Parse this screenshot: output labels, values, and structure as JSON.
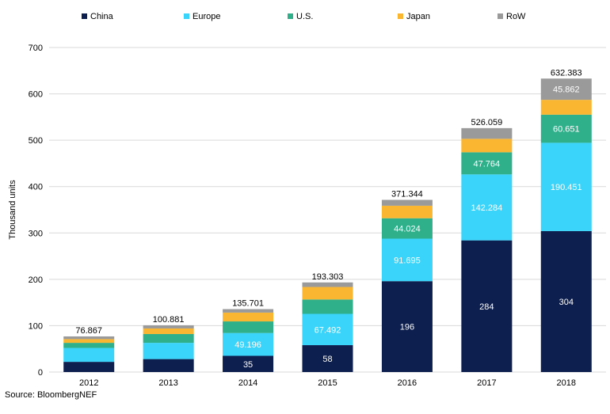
{
  "chart_data": {
    "type": "bar",
    "stacked": true,
    "categories": [
      "2012",
      "2013",
      "2014",
      "2015",
      "2016",
      "2017",
      "2018"
    ],
    "series": [
      {
        "name": "China",
        "color": "#0d1f4f",
        "values": [
          22,
          28,
          35,
          58,
          196,
          284,
          304
        ]
      },
      {
        "name": "Europe",
        "color": "#3ad4fa",
        "values": [
          30,
          35,
          49.196,
          67.492,
          91.695,
          142.284,
          190.451
        ]
      },
      {
        "name": "U.S.",
        "color": "#2fb08b",
        "values": [
          11,
          19,
          25,
          31,
          44.024,
          47.764,
          60.651
        ]
      },
      {
        "name": "Japan",
        "color": "#fbb631",
        "values": [
          8,
          12,
          19,
          27,
          27,
          29,
          32
        ]
      },
      {
        "name": "RoW",
        "color": "#9a9a9a",
        "values": [
          5.867,
          6.881,
          7.505,
          9.811,
          12.625,
          23.011,
          45.862
        ]
      }
    ],
    "segment_labels": [
      {
        "series": 0,
        "index": 2,
        "text": "35"
      },
      {
        "series": 0,
        "index": 3,
        "text": "58"
      },
      {
        "series": 0,
        "index": 4,
        "text": "196"
      },
      {
        "series": 0,
        "index": 5,
        "text": "284"
      },
      {
        "series": 0,
        "index": 6,
        "text": "304"
      },
      {
        "series": 1,
        "index": 2,
        "text": "49.196"
      },
      {
        "series": 1,
        "index": 3,
        "text": "67.492"
      },
      {
        "series": 1,
        "index": 4,
        "text": "91.695"
      },
      {
        "series": 1,
        "index": 5,
        "text": "142.284"
      },
      {
        "series": 1,
        "index": 6,
        "text": "190.451"
      },
      {
        "series": 2,
        "index": 4,
        "text": "44.024"
      },
      {
        "series": 2,
        "index": 5,
        "text": "47.764"
      },
      {
        "series": 2,
        "index": 6,
        "text": "60.651"
      },
      {
        "series": 4,
        "index": 6,
        "text": "45.862"
      }
    ],
    "totals": [
      "76.867",
      "100.881",
      "135.701",
      "193.303",
      "371.344",
      "526.059",
      "632.383"
    ],
    "ylabel": "Thousand units",
    "xlabel": "",
    "ylim": [
      0,
      700
    ],
    "yticks": [
      0,
      100,
      200,
      300,
      400,
      500,
      600,
      700
    ],
    "grid": true,
    "legend_position": "top"
  },
  "source": "Source: BloombergNEF"
}
